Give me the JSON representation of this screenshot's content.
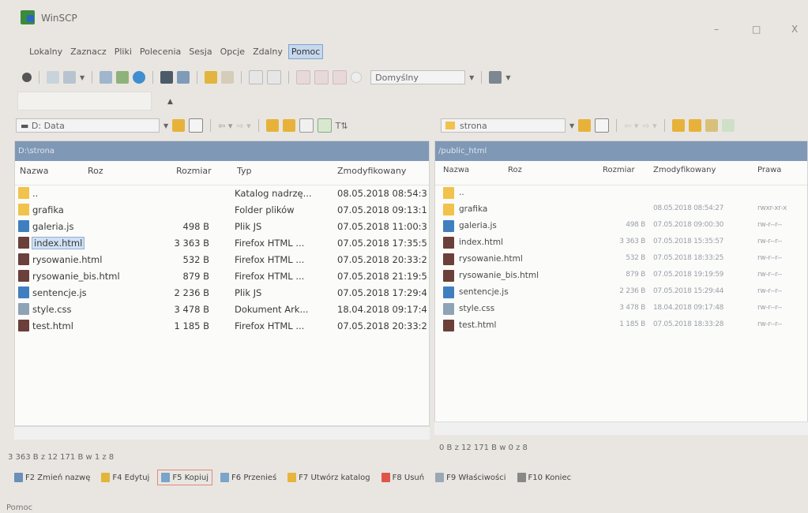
{
  "window": {
    "title": "WinSCP",
    "minimize": "–",
    "maximize": "□",
    "close": "X"
  },
  "menu": [
    "Lokalny",
    "Zaznacz",
    "Pliki",
    "Polecenia",
    "Sesja",
    "Opcje",
    "Zdalny",
    "Pomoc"
  ],
  "active_menu_index": 7,
  "toolbar": {
    "transfer_preset": "Domyślny"
  },
  "left_panel": {
    "drive": "D: Data",
    "path": "D:\\strona",
    "columns": {
      "name": "Nazwa",
      "ext": "Roz",
      "size": "Rozmiar",
      "type": "Typ",
      "modified": "Zmodyfikowany"
    },
    "rows": [
      {
        "name": "..",
        "size": "",
        "type": "Katalog nadrzę...",
        "modified": "08.05.2018 08:54:3",
        "icon": "parent-folder-icon"
      },
      {
        "name": "grafika",
        "size": "",
        "type": "Folder plików",
        "modified": "07.05.2018 09:13:1",
        "icon": "folder-icon"
      },
      {
        "name": "galeria.js",
        "size": "498 B",
        "type": "Plik JS",
        "modified": "07.05.2018 11:00:3",
        "icon": "js-file-icon"
      },
      {
        "name": "index.html",
        "size": "3 363 B",
        "type": "Firefox HTML ...",
        "modified": "07.05.2018 17:35:5",
        "icon": "html-file-icon"
      },
      {
        "name": "rysowanie.html",
        "size": "532 B",
        "type": "Firefox HTML ...",
        "modified": "07.05.2018 20:33:2",
        "icon": "html-file-icon"
      },
      {
        "name": "rysowanie_bis.html",
        "size": "879 B",
        "type": "Firefox HTML ...",
        "modified": "07.05.2018 21:19:5",
        "icon": "html-file-icon"
      },
      {
        "name": "sentencje.js",
        "size": "2 236 B",
        "type": "Plik JS",
        "modified": "07.05.2018 17:29:4",
        "icon": "js-file-icon"
      },
      {
        "name": "style.css",
        "size": "3 478 B",
        "type": "Dokument Ark...",
        "modified": "18.04.2018 09:17:4",
        "icon": "css-file-icon"
      },
      {
        "name": "test.html",
        "size": "1 185 B",
        "type": "Firefox HTML ...",
        "modified": "07.05.2018 20:33:2",
        "icon": "html-file-icon"
      }
    ],
    "status": "3 363 B z 12 171 B w 1 z 8"
  },
  "right_panel": {
    "dir": "strona",
    "path": "/public_html",
    "columns": {
      "name": "Nazwa",
      "ext": "Roz",
      "size": "Rozmiar",
      "modified": "Zmodyfikowany",
      "rights": "Prawa"
    },
    "rows": [
      {
        "name": "..",
        "size": "",
        "modified": "",
        "rights": "",
        "icon": "parent-folder-icon"
      },
      {
        "name": "grafika",
        "size": "",
        "modified": "08.05.2018 08:54:27",
        "rights": "rwxr-xr-x",
        "icon": "folder-icon"
      },
      {
        "name": "galeria.js",
        "size": "498 B",
        "modified": "07.05.2018 09:00:30",
        "rights": "rw-r--r--",
        "icon": "js-file-icon"
      },
      {
        "name": "index.html",
        "size": "3 363 B",
        "modified": "07.05.2018 15:35:57",
        "rights": "rw-r--r--",
        "icon": "html-file-icon"
      },
      {
        "name": "rysowanie.html",
        "size": "532 B",
        "modified": "07.05.2018 18:33:25",
        "rights": "rw-r--r--",
        "icon": "html-file-icon"
      },
      {
        "name": "rysowanie_bis.html",
        "size": "879 B",
        "modified": "07.05.2018 19:19:59",
        "rights": "rw-r--r--",
        "icon": "html-file-icon"
      },
      {
        "name": "sentencje.js",
        "size": "2 236 B",
        "modified": "07.05.2018 15:29:44",
        "rights": "rw-r--r--",
        "icon": "js-file-icon"
      },
      {
        "name": "style.css",
        "size": "3 478 B",
        "modified": "18.04.2018 09:17:48",
        "rights": "rw-r--r--",
        "icon": "css-file-icon"
      },
      {
        "name": "test.html",
        "size": "1 185 B",
        "modified": "07.05.2018 18:33:28",
        "rights": "rw-r--r--",
        "icon": "html-file-icon"
      }
    ],
    "status": "0 B z 12 171 B w 0 z 8"
  },
  "function_keys": [
    {
      "label": "F2 Zmień nazwę",
      "icon": "rename-icon",
      "color": "#6b8fb8"
    },
    {
      "label": "F4 Edytuj",
      "icon": "edit-icon",
      "color": "#e2b43a"
    },
    {
      "label": "F5 Kopiuj",
      "icon": "copy-icon",
      "color": "#7aa4c9"
    },
    {
      "label": "F6 Przenieś",
      "icon": "move-icon",
      "color": "#7aa4c9"
    },
    {
      "label": "F7 Utwórz katalog",
      "icon": "new-folder-icon",
      "color": "#e7b43c"
    },
    {
      "label": "F8 Usuń",
      "icon": "delete-icon",
      "color": "#e0554a"
    },
    {
      "label": "F9 Właściwości",
      "icon": "properties-icon",
      "color": "#9aa8b4"
    },
    {
      "label": "F10 Koniec",
      "icon": "quit-icon",
      "color": "#888888"
    }
  ],
  "highlighted_function_key_index": 2,
  "help_text": "Pomoc",
  "colors": {
    "panel_header": "#7f98b5",
    "selection": "#cfe0f3",
    "highlight_border": "#e08a7e",
    "folder": "#f1c24c",
    "html_icon": "#6b3f3a",
    "js_icon": "#3f7fc0",
    "css_icon": "#8fa3b6"
  }
}
